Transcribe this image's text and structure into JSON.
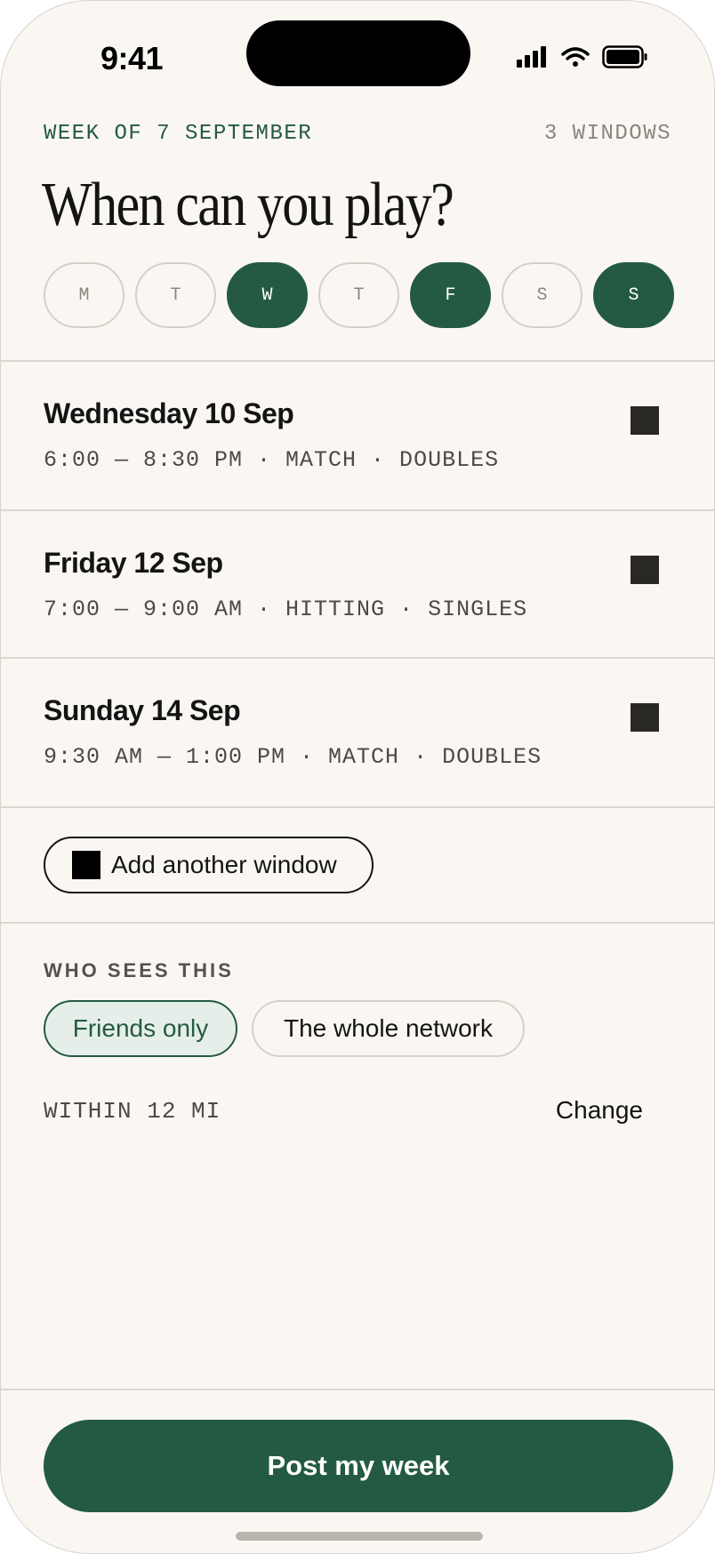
{
  "status_bar": {
    "time": "9:41",
    "icons": [
      "signal-icon",
      "wifi-icon",
      "battery-icon"
    ]
  },
  "header": {
    "week_label": "WEEK OF 7 SEPTEMBER",
    "windows_count": "3 WINDOWS",
    "title": "When can you play?"
  },
  "days": [
    {
      "label": "M",
      "selected": false
    },
    {
      "label": "T",
      "selected": false
    },
    {
      "label": "W",
      "selected": true
    },
    {
      "label": "T",
      "selected": false
    },
    {
      "label": "F",
      "selected": true
    },
    {
      "label": "S",
      "selected": false
    },
    {
      "label": "S",
      "selected": true
    }
  ],
  "slots": [
    {
      "day": "Wednesday 10 Sep",
      "meta": "6:00 — 8:30 PM · MATCH · DOUBLES"
    },
    {
      "day": "Friday 12 Sep",
      "meta": "7:00 — 9:00 AM · HITTING · SINGLES"
    },
    {
      "day": "Sunday 14 Sep",
      "meta": "9:30 AM — 1:00 PM · MATCH · DOUBLES"
    }
  ],
  "add_window_label": "Add another window",
  "visibility": {
    "label": "WHO SEES THIS",
    "options": [
      {
        "label": "Friends only",
        "selected": true
      },
      {
        "label": "The whole network",
        "selected": false
      }
    ]
  },
  "radius": {
    "label": "WITHIN 12 MI",
    "change_label": "Change"
  },
  "post_button_label": "Post my week",
  "colors": {
    "accent": "#245a42",
    "background": "#faf7f3",
    "chip_selected_bg": "#e6eeea"
  }
}
